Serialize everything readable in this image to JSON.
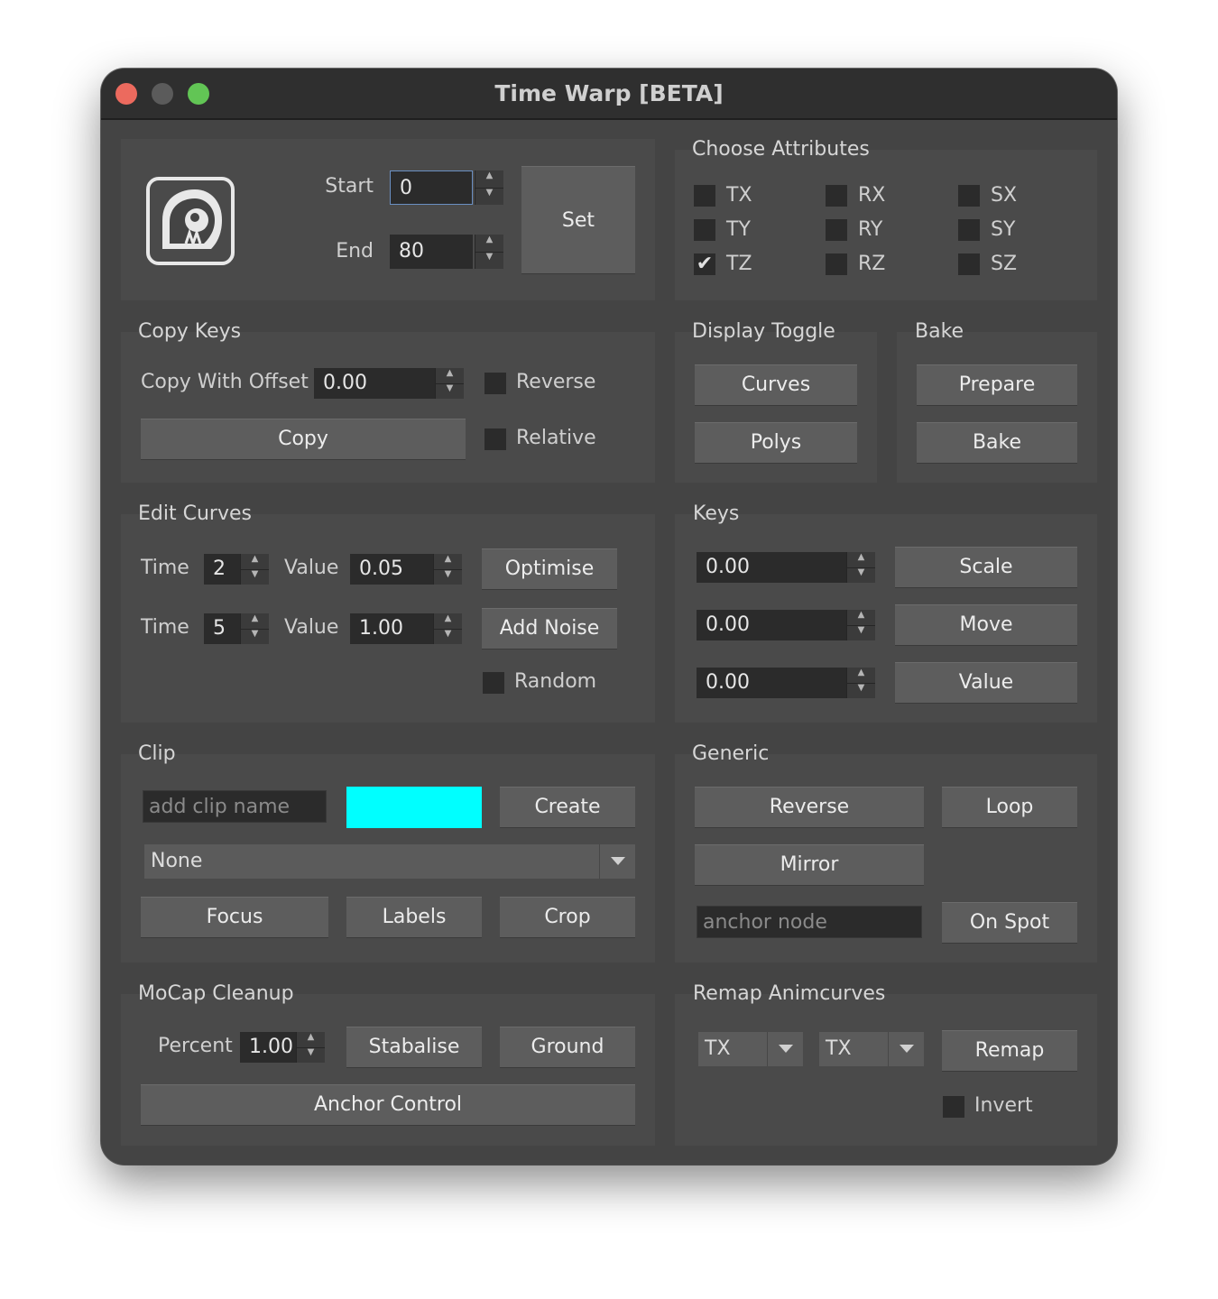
{
  "window": {
    "title": "Time Warp [BETA]"
  },
  "range": {
    "start_label": "Start",
    "start_value": "0",
    "end_label": "End",
    "end_value": "80",
    "set_label": "Set"
  },
  "attributes": {
    "title": "Choose Attributes",
    "items": [
      {
        "label": "TX",
        "checked": false
      },
      {
        "label": "RX",
        "checked": false
      },
      {
        "label": "SX",
        "checked": false
      },
      {
        "label": "TY",
        "checked": false
      },
      {
        "label": "RY",
        "checked": false
      },
      {
        "label": "SY",
        "checked": false
      },
      {
        "label": "TZ",
        "checked": true
      },
      {
        "label": "RZ",
        "checked": false
      },
      {
        "label": "SZ",
        "checked": false
      }
    ]
  },
  "copy_keys": {
    "title": "Copy Keys",
    "offset_label": "Copy With Offset",
    "offset_value": "0.00",
    "reverse_label": "Reverse",
    "relative_label": "Relative",
    "copy_label": "Copy"
  },
  "display_toggle": {
    "title": "Display Toggle",
    "curves_label": "Curves",
    "polys_label": "Polys"
  },
  "bake": {
    "title": "Bake",
    "prepare_label": "Prepare",
    "bake_label": "Bake"
  },
  "edit_curves": {
    "title": "Edit Curves",
    "time_label": "Time",
    "value_label": "Value",
    "time1": "2",
    "value1": "0.05",
    "time2": "5",
    "value2": "1.00",
    "optimise_label": "Optimise",
    "add_noise_label": "Add Noise",
    "random_label": "Random"
  },
  "keys": {
    "title": "Keys",
    "v1": "0.00",
    "v2": "0.00",
    "v3": "0.00",
    "scale_label": "Scale",
    "move_label": "Move",
    "value_label": "Value"
  },
  "clip": {
    "title": "Clip",
    "name_placeholder": "add clip name",
    "color": "#00ffff",
    "create_label": "Create",
    "selected": "None",
    "focus_label": "Focus",
    "labels_label": "Labels",
    "crop_label": "Crop"
  },
  "generic": {
    "title": "Generic",
    "reverse_label": "Reverse",
    "loop_label": "Loop",
    "mirror_label": "Mirror",
    "anchor_placeholder": "anchor node",
    "on_spot_label": "On Spot"
  },
  "mocap": {
    "title": "MoCap Cleanup",
    "percent_label": "Percent",
    "percent_value": "1.00",
    "stabalise_label": "Stabalise",
    "ground_label": "Ground",
    "anchor_control_label": "Anchor Control"
  },
  "remap": {
    "title": "Remap Animcurves",
    "from": "TX",
    "to": "TX",
    "remap_label": "Remap",
    "invert_label": "Invert"
  }
}
